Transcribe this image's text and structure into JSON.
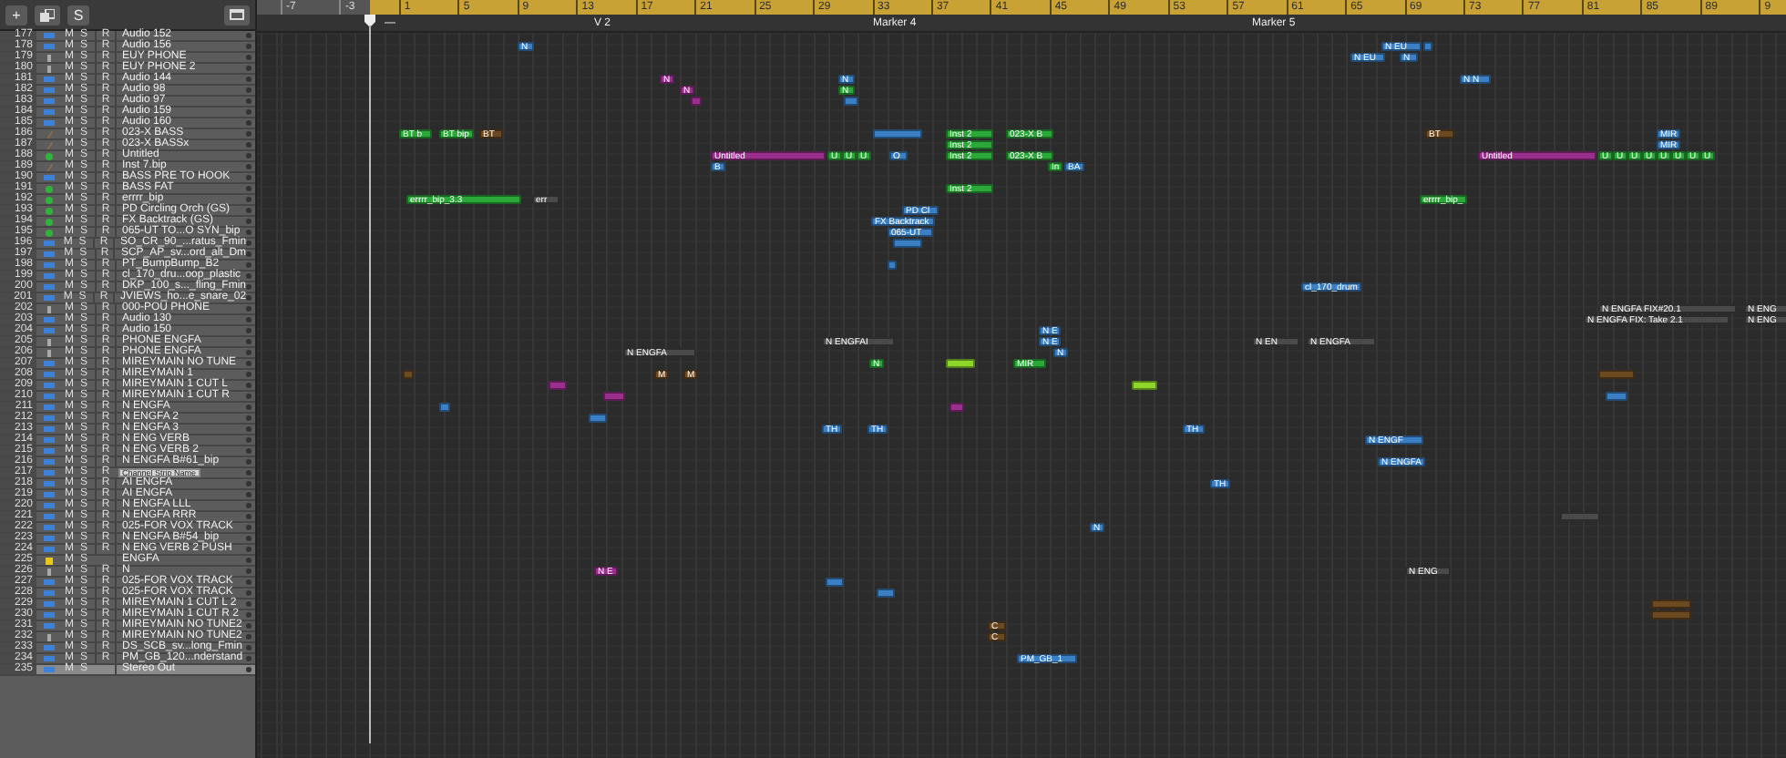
{
  "toolbar": {
    "add_button": "+",
    "solo_button": "S"
  },
  "ruler": {
    "bars": [
      "-7",
      "-3",
      "1",
      "5",
      "9",
      "13",
      "17",
      "21",
      "25",
      "29",
      "33",
      "37",
      "41",
      "45",
      "49",
      "53",
      "57",
      "61",
      "65",
      "69",
      "73",
      "77",
      "81",
      "85",
      "89",
      "9"
    ]
  },
  "markers": [
    {
      "label": "—"
    },
    {
      "label": "V 2"
    },
    {
      "label": "Marker 4"
    },
    {
      "label": "Marker 5"
    }
  ],
  "tooltip": {
    "text": "Channel Strip Name"
  },
  "tracks": [
    {
      "number": "177",
      "name": "Audio 152",
      "kind": "audio",
      "mute": "M",
      "solo": "S",
      "rec": "R",
      "selected": false
    },
    {
      "number": "178",
      "name": "Audio 156",
      "kind": "audio",
      "mute": "M",
      "solo": "S",
      "rec": "R",
      "selected": false,
      "regions": [
        {
          "label": "N",
          "color": "#3b7fc4"
        },
        {
          "label": "N EU",
          "color": "#3b7fc4"
        },
        {
          "color": "#3b7fc4"
        }
      ]
    },
    {
      "number": "179",
      "name": "EUY PHONE",
      "kind": "mic",
      "mute": "M",
      "solo": "S",
      "rec": "R",
      "selected": false,
      "regions": [
        {
          "label": "N EU",
          "color": "#3b7fc4"
        },
        {
          "label": "N",
          "color": "#3b7fc4"
        }
      ]
    },
    {
      "number": "180",
      "name": "EUY PHONE 2",
      "kind": "mic",
      "mute": "M",
      "solo": "S",
      "rec": "R",
      "selected": false
    },
    {
      "number": "181",
      "name": "Audio 144",
      "kind": "audio",
      "mute": "M",
      "solo": "S",
      "rec": "R",
      "selected": false,
      "regions": [
        {
          "label": "N",
          "color": "#9b2f8e"
        },
        {
          "label": "N",
          "color": "#3b7fc4"
        },
        {
          "label": "N N",
          "color": "#3b7fc4"
        }
      ]
    },
    {
      "number": "182",
      "name": "Audio 98",
      "kind": "audio",
      "mute": "M",
      "solo": "S",
      "rec": "R",
      "selected": false,
      "regions": [
        {
          "label": "N",
          "color": "#9b2f8e"
        },
        {
          "label": "N",
          "color": "#2aa838"
        }
      ]
    },
    {
      "number": "183",
      "name": "Audio 97",
      "kind": "audio",
      "mute": "M",
      "solo": "S",
      "rec": "R",
      "selected": false,
      "regions": [
        {
          "color": "#9b2f8e"
        },
        {
          "color": "#3b7fc4"
        }
      ]
    },
    {
      "number": "184",
      "name": "Audio 159",
      "kind": "audio",
      "mute": "M",
      "solo": "S",
      "rec": "R",
      "selected": false
    },
    {
      "number": "185",
      "name": "Audio 160",
      "kind": "audio",
      "mute": "M",
      "solo": "S",
      "rec": "R",
      "selected": false
    },
    {
      "number": "186",
      "name": "023-X BASS",
      "kind": "midi",
      "mute": "M",
      "solo": "S",
      "rec": "R",
      "selected": false,
      "regions": [
        {
          "label": "BT b",
          "color": "#2aa838"
        },
        {
          "label": "BT bip",
          "color": "#2aa838"
        },
        {
          "label": "BT",
          "color": "#6b4a22"
        },
        {
          "color": "#3b7fc4"
        },
        {
          "label": "Inst 2",
          "color": "#2aa838"
        },
        {
          "label": "023-X B",
          "color": "#2aa838"
        },
        {
          "label": "BT",
          "color": "#6b4a22"
        },
        {
          "label": "MIR",
          "color": "#3b7fc4"
        }
      ]
    },
    {
      "number": "187",
      "name": "023-X BASSx",
      "kind": "midi",
      "mute": "M",
      "solo": "S",
      "rec": "R",
      "selected": false,
      "regions": [
        {
          "label": "Inst 2",
          "color": "#2aa838"
        },
        {
          "label": "MIR",
          "color": "#3b7fc4"
        }
      ]
    },
    {
      "number": "188",
      "name": "Untitled",
      "kind": "inst",
      "mute": "M",
      "solo": "S",
      "rec": "R",
      "selected": false,
      "regions": [
        {
          "label": "Untitled",
          "color": "#9b2f8e"
        },
        {
          "label": "U",
          "color": "#2aa838"
        },
        {
          "label": "U",
          "color": "#2aa838"
        },
        {
          "label": "U",
          "color": "#2aa838"
        },
        {
          "label": "O",
          "color": "#3b7fc4"
        },
        {
          "label": "Inst 2",
          "color": "#2aa838"
        },
        {
          "label": "023-X B",
          "color": "#2aa838"
        },
        {
          "label": "Untitled",
          "color": "#9b2f8e"
        },
        {
          "label": "U",
          "color": "#2aa838"
        },
        {
          "label": "U",
          "color": "#2aa838"
        },
        {
          "label": "U",
          "color": "#2aa838"
        },
        {
          "label": "U",
          "color": "#2aa838"
        },
        {
          "label": "U",
          "color": "#2aa838"
        },
        {
          "label": "U",
          "color": "#2aa838"
        },
        {
          "label": "U",
          "color": "#2aa838"
        },
        {
          "label": "U",
          "color": "#2aa838"
        }
      ]
    },
    {
      "number": "189",
      "name": "Inst 7.bip",
      "kind": "midi",
      "mute": "M",
      "solo": "S",
      "rec": "R",
      "selected": false,
      "regions": [
        {
          "label": "B",
          "color": "#3b7fc4"
        },
        {
          "label": "In",
          "color": "#2aa838"
        },
        {
          "label": "BA",
          "color": "#3b7fc4"
        }
      ]
    },
    {
      "number": "190",
      "name": "BASS PRE TO HOOK",
      "kind": "audio",
      "mute": "M",
      "solo": "S",
      "rec": "R",
      "selected": false
    },
    {
      "number": "191",
      "name": "BASS FAT",
      "kind": "inst",
      "mute": "M",
      "solo": "S",
      "rec": "R",
      "selected": false,
      "regions": [
        {
          "label": "Inst 2",
          "color": "#2aa838"
        }
      ]
    },
    {
      "number": "192",
      "name": "errrr_bip",
      "kind": "inst",
      "mute": "M",
      "solo": "S",
      "rec": "R",
      "selected": false,
      "regions": [
        {
          "label": "errrr_bip_3.3",
          "color": "#2aa838"
        },
        {
          "label": "err",
          "color": "#4a4a4a"
        },
        {
          "label": "errrr_bip_",
          "color": "#2aa838"
        }
      ]
    },
    {
      "number": "193",
      "name": "PD Circling Orch (GS)",
      "kind": "inst",
      "mute": "M",
      "solo": "S",
      "rec": "R",
      "selected": false,
      "regions": [
        {
          "label": "PD Cl",
          "color": "#3b7fc4"
        }
      ]
    },
    {
      "number": "194",
      "name": "FX Backtrack (GS)",
      "kind": "inst",
      "mute": "M",
      "solo": "S",
      "rec": "R",
      "selected": false,
      "regions": [
        {
          "label": "FX Backtrack",
          "color": "#3b7fc4"
        }
      ]
    },
    {
      "number": "195",
      "name": "065-UT TO...O SYN_bip",
      "kind": "inst",
      "mute": "M",
      "solo": "S",
      "rec": "R",
      "selected": false,
      "regions": [
        {
          "label": "065-UT",
          "color": "#3b7fc4"
        }
      ]
    },
    {
      "number": "196",
      "name": "SO_CR_90_...ratus_Fmin",
      "kind": "audio",
      "mute": "M",
      "solo": "S",
      "rec": "R",
      "selected": false,
      "regions": [
        {
          "color": "#3b7fc4"
        }
      ]
    },
    {
      "number": "197",
      "name": "SCP_AP_sv...ord_alt_Dm",
      "kind": "audio",
      "mute": "M",
      "solo": "S",
      "rec": "R",
      "selected": false
    },
    {
      "number": "198",
      "name": "PT_BumpBump_B2",
      "kind": "audio",
      "mute": "M",
      "solo": "S",
      "rec": "R",
      "selected": false,
      "regions": [
        {
          "color": "#3b7fc4"
        }
      ]
    },
    {
      "number": "199",
      "name": "cl_170_dru...oop_plastic",
      "kind": "audio",
      "mute": "M",
      "solo": "S",
      "rec": "R",
      "selected": false
    },
    {
      "number": "200",
      "name": "DKP_100_s..._fling_Fmin",
      "kind": "audio",
      "mute": "M",
      "solo": "S",
      "rec": "R",
      "selected": false,
      "regions": [
        {
          "label": "cl_170_drum",
          "color": "#3b7fc4"
        }
      ]
    },
    {
      "number": "201",
      "name": "JVIEWS_ho...e_snare_02",
      "kind": "audio",
      "mute": "M",
      "solo": "S",
      "rec": "R",
      "selected": false
    },
    {
      "number": "202",
      "name": "000-POU PHONE",
      "kind": "mic",
      "mute": "M",
      "solo": "S",
      "rec": "R",
      "selected": false,
      "regions": [
        {
          "label": "N ENGFA FIX#20.1",
          "color": "#4a4a4a"
        },
        {
          "label": "N ENG",
          "color": "#4a4a4a"
        }
      ]
    },
    {
      "number": "203",
      "name": "Audio 130",
      "kind": "audio",
      "mute": "M",
      "solo": "S",
      "rec": "R",
      "selected": false,
      "regions": [
        {
          "label": "N ENGFA FIX: Take 2.1",
          "color": "#4a4a4a"
        },
        {
          "label": "N ENG",
          "color": "#4a4a4a"
        }
      ]
    },
    {
      "number": "204",
      "name": "Audio 150",
      "kind": "audio",
      "mute": "M",
      "solo": "S",
      "rec": "R",
      "selected": false,
      "regions": [
        {
          "label": "N E",
          "color": "#3b7fc4"
        }
      ]
    },
    {
      "number": "205",
      "name": "PHONE ENGFA",
      "kind": "mic",
      "mute": "M",
      "solo": "S",
      "rec": "R",
      "selected": false,
      "regions": [
        {
          "label": "N ENGFAI",
          "color": "#4a4a4a"
        },
        {
          "label": "N E",
          "color": "#3b7fc4"
        },
        {
          "label": "N EN",
          "color": "#4a4a4a"
        },
        {
          "label": "N ENGFA",
          "color": "#4a4a4a"
        }
      ]
    },
    {
      "number": "206",
      "name": "PHONE ENGFA",
      "kind": "mic",
      "mute": "M",
      "solo": "S",
      "rec": "R",
      "selected": false,
      "regions": [
        {
          "label": "N ENGFA",
          "color": "#4a4a4a"
        },
        {
          "label": "N",
          "color": "#3b7fc4"
        }
      ]
    },
    {
      "number": "207",
      "name": "MIREYMAIN NO TUNE",
      "kind": "audio",
      "mute": "M",
      "solo": "S",
      "rec": "R",
      "selected": false,
      "regions": [
        {
          "label": "N",
          "color": "#2aa838"
        },
        {
          "color": "#8fd62a"
        },
        {
          "label": "MIR",
          "color": "#2aa838"
        }
      ]
    },
    {
      "number": "208",
      "name": "MIREYMAIN 1",
      "kind": "audio",
      "mute": "M",
      "solo": "S",
      "rec": "R",
      "selected": false,
      "regions": [
        {
          "color": "#6b4a22"
        },
        {
          "label": "M",
          "color": "#6b4a22"
        },
        {
          "label": "M",
          "color": "#6b4a22"
        },
        {
          "color": "#6b4a22"
        }
      ]
    },
    {
      "number": "209",
      "name": "MIREYMAIN 1 CUT L",
      "kind": "audio",
      "mute": "M",
      "solo": "S",
      "rec": "R",
      "selected": false,
      "regions": [
        {
          "color": "#9b2f8e"
        },
        {
          "color": "#8fd62a"
        }
      ]
    },
    {
      "number": "210",
      "name": "MIREYMAIN 1  CUT R",
      "kind": "audio",
      "mute": "M",
      "solo": "S",
      "rec": "R",
      "selected": false,
      "regions": [
        {
          "color": "#9b2f8e"
        },
        {
          "color": "#3b7fc4"
        }
      ]
    },
    {
      "number": "211",
      "name": "N ENGFA",
      "kind": "audio",
      "mute": "M",
      "solo": "S",
      "rec": "R",
      "selected": false,
      "regions": [
        {
          "color": "#3b7fc4"
        },
        {
          "color": "#9b2f8e"
        }
      ]
    },
    {
      "number": "212",
      "name": "N ENGFA 2",
      "kind": "audio",
      "mute": "M",
      "solo": "S",
      "rec": "R",
      "selected": false,
      "regions": [
        {
          "color": "#3b7fc4"
        }
      ]
    },
    {
      "number": "213",
      "name": "N ENGFA 3",
      "kind": "audio",
      "mute": "M",
      "solo": "S",
      "rec": "R",
      "selected": false,
      "regions": [
        {
          "label": "TH",
          "color": "#3b7fc4"
        },
        {
          "label": "TH",
          "color": "#3b7fc4"
        },
        {
          "label": "TH",
          "color": "#3b7fc4"
        }
      ]
    },
    {
      "number": "214",
      "name": "N ENG VERB",
      "kind": "audio",
      "mute": "M",
      "solo": "S",
      "rec": "R",
      "selected": false,
      "regions": [
        {
          "label": "N ENGF",
          "color": "#3b7fc4"
        }
      ]
    },
    {
      "number": "215",
      "name": "N ENG VERB 2",
      "kind": "audio",
      "mute": "M",
      "solo": "S",
      "rec": "R",
      "selected": false
    },
    {
      "number": "216",
      "name": "N ENGFA B#61_bip",
      "kind": "audio",
      "mute": "M",
      "solo": "S",
      "rec": "R",
      "selected": false,
      "regions": [
        {
          "label": "N ENGFA",
          "color": "#3b7fc4"
        }
      ]
    },
    {
      "number": "217",
      "kind": "audio",
      "mute": "M",
      "solo": "S",
      "rec": "R",
      "selected": false,
      "tooltip": true
    },
    {
      "number": "218",
      "name": "AI ENGFA",
      "kind": "audio",
      "mute": "M",
      "solo": "S",
      "rec": "R",
      "selected": false,
      "regions": [
        {
          "label": "TH",
          "color": "#3b7fc4"
        }
      ]
    },
    {
      "number": "219",
      "name": "AI ENGFA",
      "kind": "audio",
      "mute": "M",
      "solo": "S",
      "rec": "R",
      "selected": false
    },
    {
      "number": "220",
      "name": "N ENGFA LLL",
      "kind": "audio",
      "mute": "M",
      "solo": "S",
      "rec": "R",
      "selected": false
    },
    {
      "number": "221",
      "name": "N ENGFA RRR",
      "kind": "audio",
      "mute": "M",
      "solo": "S",
      "rec": "R",
      "selected": false,
      "regions": [
        {
          "color": "#4a4a4a"
        }
      ]
    },
    {
      "number": "222",
      "name": "025-FOR VOX TRACK",
      "kind": "audio",
      "mute": "M",
      "solo": "S",
      "rec": "R",
      "selected": false,
      "regions": [
        {
          "label": "N",
          "color": "#3b7fc4"
        }
      ]
    },
    {
      "number": "223",
      "name": "N ENGFA B#54_bip",
      "kind": "audio",
      "mute": "M",
      "solo": "S",
      "rec": "R",
      "selected": false
    },
    {
      "number": "224",
      "name": "N ENG VERB 2 PUSH",
      "kind": "audio",
      "mute": "M",
      "solo": "S",
      "rec": "R",
      "selected": false
    },
    {
      "number": "225",
      "name": "ENGFA",
      "kind": "aux",
      "mute": "M",
      "solo": "S",
      "selected": false
    },
    {
      "number": "226",
      "name": "N",
      "kind": "mic",
      "mute": "M",
      "solo": "S",
      "rec": "R",
      "selected": false,
      "regions": [
        {
          "label": "N E",
          "color": "#9b2f8e"
        },
        {
          "label": "N ENG",
          "color": "#4a4a4a"
        }
      ]
    },
    {
      "number": "227",
      "name": "025-FOR VOX TRACK",
      "kind": "audio",
      "mute": "M",
      "solo": "S",
      "rec": "R",
      "selected": false,
      "regions": [
        {
          "color": "#3b7fc4"
        }
      ]
    },
    {
      "number": "228",
      "name": "025-FOR VOX TRACK",
      "kind": "audio",
      "mute": "M",
      "solo": "S",
      "rec": "R",
      "selected": false,
      "regions": [
        {
          "color": "#3b7fc4"
        }
      ]
    },
    {
      "number": "229",
      "name": "MIREYMAIN 1 CUT L 2",
      "kind": "audio",
      "mute": "M",
      "solo": "S",
      "rec": "R",
      "selected": false,
      "regions": [
        {
          "color": "#6b4a22"
        }
      ]
    },
    {
      "number": "230",
      "name": "MIREYMAIN 1  CUT R 2",
      "kind": "audio",
      "mute": "M",
      "solo": "S",
      "rec": "R",
      "selected": false,
      "regions": [
        {
          "color": "#6b4a22"
        }
      ]
    },
    {
      "number": "231",
      "name": "MIREYMAIN NO TUNE2",
      "kind": "audio",
      "mute": "M",
      "solo": "S",
      "rec": "R",
      "selected": false,
      "regions": [
        {
          "label": "C",
          "color": "#6b4a22"
        }
      ]
    },
    {
      "number": "232",
      "name": "MIREYMAIN NO TUNE2",
      "kind": "mic",
      "mute": "M",
      "solo": "S",
      "rec": "R",
      "selected": false,
      "regions": [
        {
          "label": "C",
          "color": "#6b4a22"
        }
      ]
    },
    {
      "number": "233",
      "name": "DS_SCB_sv...long_Fmin",
      "kind": "audio",
      "mute": "M",
      "solo": "S",
      "rec": "R",
      "selected": false
    },
    {
      "number": "234",
      "name": "PM_GB_120...nderstand",
      "kind": "audio",
      "mute": "M",
      "solo": "S",
      "rec": "R",
      "selected": false,
      "regions": [
        {
          "label": "PM_GB_1",
          "color": "#3b7fc4"
        }
      ]
    },
    {
      "number": "235",
      "name": "Stereo Out",
      "kind": "audio",
      "mute": "M",
      "solo": "S",
      "selected": true
    }
  ]
}
